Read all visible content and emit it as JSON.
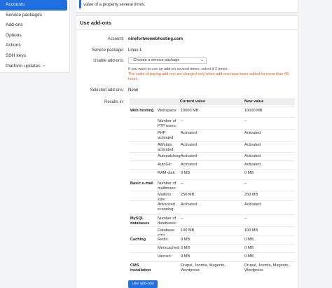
{
  "sidebar": {
    "items": [
      {
        "label": "Accounts",
        "active": true
      },
      {
        "label": "Service packages"
      },
      {
        "label": "Add-ons"
      },
      {
        "label": "Options"
      },
      {
        "label": "Actions"
      },
      {
        "label": "SSH keys"
      },
      {
        "label": "Platform updates",
        "external": true
      }
    ]
  },
  "notice": {
    "text": "value of a property several times."
  },
  "card": {
    "title": "Use add-ons",
    "account_label": "Account:",
    "account_value": "ninefortwowebhosting.com",
    "package_label": "Service package:",
    "package_value": "Linux 1",
    "usable_label": "Usable add-ons:",
    "select_placeholder": "- Choose a service package",
    "hint": "If you want to use an add-on several times, select it 2 times.",
    "warning": "The costs of paying add-ons are charged only when add-ons have been added for more than 48 hours.",
    "selected_label": "Selected add-ons:",
    "selected_value": "None",
    "results_label": "Results in:",
    "submit_label": "Use add-ons"
  },
  "table": {
    "headers": {
      "current": "Current value",
      "new": "New value"
    },
    "rows": [
      {
        "category": "Web hosting",
        "label": "Webspace:",
        "current": "10000 MB",
        "new": "10000 MB"
      },
      {
        "label": "Number of FTP users:",
        "current": "–",
        "new": "–"
      },
      {
        "label": "PHP activated:",
        "current": "Activated",
        "new": "Activated"
      },
      {
        "label": "AWstats activated:",
        "current": "Activated",
        "new": "Activated"
      },
      {
        "label": "Autopatching:",
        "current": "Activated",
        "new": "Activated"
      },
      {
        "label": "AutoGit:",
        "current": "Activated",
        "new": "Activated"
      },
      {
        "label": "RAM-disk:",
        "current": "0 MB",
        "new": "0 MB"
      },
      {
        "category": "Basic e-mail",
        "label": "Number of mailboxes:",
        "current": "–",
        "new": "–"
      },
      {
        "label": "Mailbox size:",
        "current": "250 MB",
        "new": "250 MB"
      },
      {
        "label": "Advanced scanning:",
        "current": "Activated",
        "new": "Activated"
      },
      {
        "category": "MySQL databases",
        "label": "Number of databases:",
        "current": "–",
        "new": "–"
      },
      {
        "label": "Database size:",
        "current": "100 MB",
        "new": "100 MB"
      },
      {
        "category": "Caching",
        "label": "Redis:",
        "current": "0 MB",
        "new": "0 MB"
      },
      {
        "label": "Memcached:",
        "current": "0 MB",
        "new": "0 MB"
      },
      {
        "label": "Varnish:",
        "current": "0 MB",
        "new": "0 MB"
      },
      {
        "category": "CMS installation",
        "label": "",
        "current": "Drupal, Joomla, Magento, Wordpress",
        "new": "Drupal, Joomla, Magento, Wordpress"
      }
    ]
  },
  "colors": {
    "accent": "#1f6fe0",
    "warning": "#e65a1c"
  }
}
